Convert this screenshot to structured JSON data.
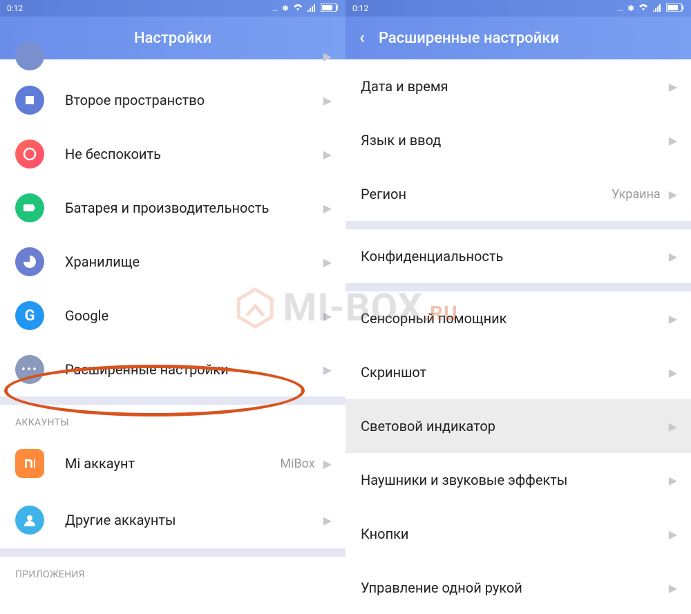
{
  "left": {
    "status": {
      "time": "0:12"
    },
    "header": {
      "title": "Настройки"
    },
    "rows": [
      {
        "label": "Второе пространство"
      },
      {
        "label": "Не беспокоить"
      },
      {
        "label": "Батарея и производительность"
      },
      {
        "label": "Хранилище"
      },
      {
        "label": "Google"
      },
      {
        "label": "Расширенные настройки"
      }
    ],
    "section_accounts": "АККАУНТЫ",
    "mi_account": {
      "label": "Mi аккаунт",
      "value": "MiBox"
    },
    "other_accounts": "Другие аккаунты",
    "section_apps": "ПРИЛОЖЕНИЯ"
  },
  "right": {
    "status": {
      "time": "0:12"
    },
    "header": {
      "title": "Расширенные настройки"
    },
    "rows": [
      {
        "label": "Дата и время"
      },
      {
        "label": "Язык и ввод"
      },
      {
        "label": "Регион",
        "value": "Украина"
      },
      {
        "label": "Конфиденциальность"
      },
      {
        "label": "Сенсорный помощник"
      },
      {
        "label": "Скриншот"
      },
      {
        "label": "Световой индикатор"
      },
      {
        "label": "Наушники и звуковые эффекты"
      },
      {
        "label": "Кнопки"
      },
      {
        "label": "Управление одной рукой"
      }
    ]
  },
  "watermark": "MI-BOX",
  "watermark_suffix": ".RU",
  "icons": {
    "partial_top": "#7a8fce",
    "second_space": "#5f7dd6",
    "dnd": "#ff5a52",
    "battery": "#1fc47a",
    "storage": "#6a7fd0",
    "google": "#2196f3",
    "advanced": "#8a99bc",
    "mi": "#ff8a3c",
    "other": "#3fb3e8"
  }
}
